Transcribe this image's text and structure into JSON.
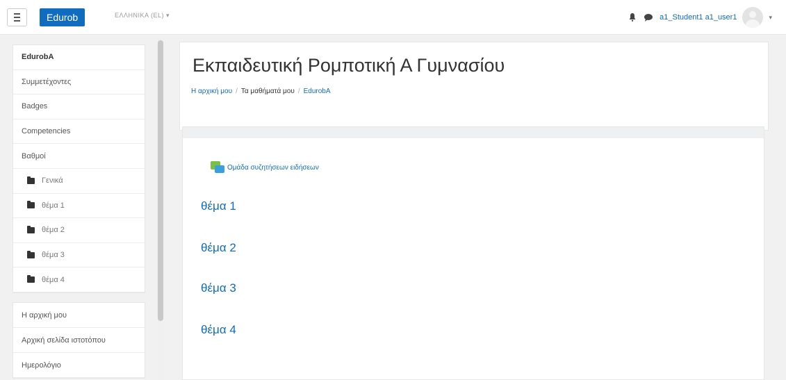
{
  "navbar": {
    "brand": "Edurob",
    "language": "ΕΛΛΗΝΙΚΑ (EL) ▾",
    "username": "a1_Student1 a1_user1",
    "caret": "▾",
    "icons": [
      "menu-icon",
      "bell-icon",
      "chat-icon",
      "avatar-icon"
    ]
  },
  "sidebar": {
    "course_items": [
      "EdurobA",
      "Συμμετέχοντες",
      "Badges",
      "Competencies",
      "Βαθμοί",
      "Γενικά",
      "θέμα 1",
      "θέμα 2",
      "θέμα 3",
      "θέμα 4"
    ],
    "site_items": [
      "Η αρχική μου",
      "Αρχική σελίδα ιστοτόπου",
      "Ημερολόγιο"
    ]
  },
  "header": {
    "title": "Εκπαιδευτική Ρομποτική Α Γυμνασίου",
    "breadcrumb": {
      "home": "Η αρχική μου",
      "sep": "/",
      "courses": "Τα μαθήματά μου",
      "course": "EdurobA"
    }
  },
  "main": {
    "forum_label": "Ομάδα συζητήσεων ειδήσεων",
    "sections": [
      "θέμα 1",
      "θέμα 2",
      "θέμα 3",
      "θέμα 4"
    ]
  },
  "colors": {
    "accent": "#0f6cbf",
    "background": "#f1f1f1"
  }
}
